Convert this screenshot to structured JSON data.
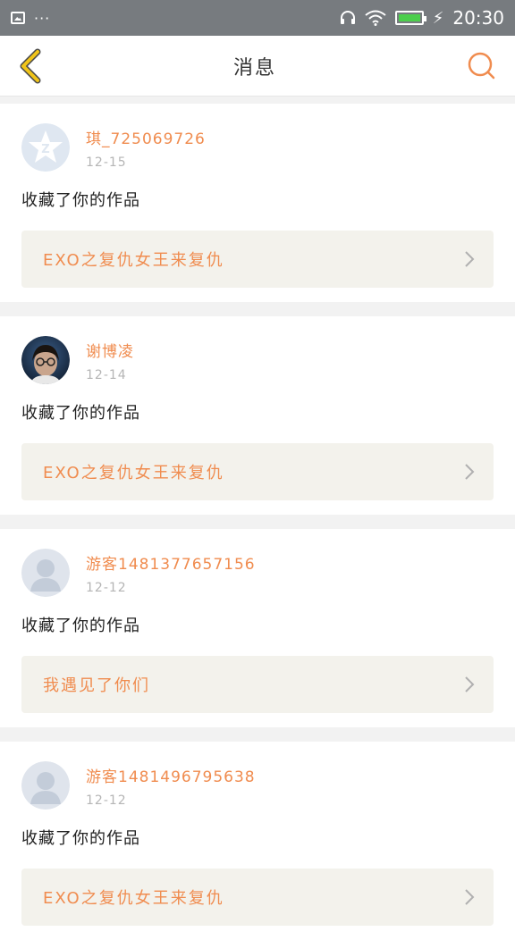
{
  "status_bar": {
    "time": "20:30",
    "dots": "···"
  },
  "nav": {
    "title": "消息"
  },
  "messages": [
    {
      "name": "琪_725069726",
      "date": "12-15",
      "action": "收藏了你的作品",
      "work_title": "EXO之复仇女王来复仇",
      "avatar": "qq-default"
    },
    {
      "name": "谢博凌",
      "date": "12-14",
      "action": "收藏了你的作品",
      "work_title": "EXO之复仇女王来复仇",
      "avatar": "photo"
    },
    {
      "name": "游客1481377657156",
      "date": "12-12",
      "action": "收藏了你的作品",
      "work_title": "我遇见了你们",
      "avatar": "guest-default"
    },
    {
      "name": "游客1481496795638",
      "date": "12-12",
      "action": "收藏了你的作品",
      "work_title": "EXO之复仇女王来复仇",
      "avatar": "guest-default"
    }
  ],
  "colors": {
    "accent": "#f08c4f",
    "back_arrow": "#f0c419",
    "status_bar": "#777b7f"
  }
}
